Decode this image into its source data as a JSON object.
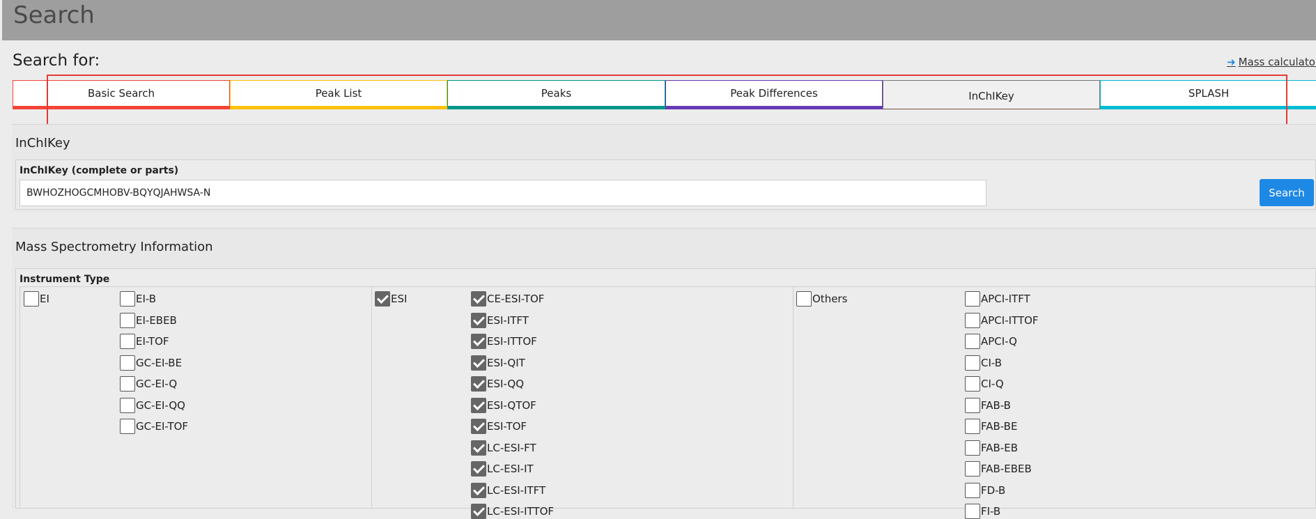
{
  "header": {
    "title": "Search"
  },
  "search_for_label": "Search for:",
  "mass_calculator_link": "Mass calculator",
  "tabs": [
    {
      "label": "Basic Search",
      "color": "#f44336",
      "active": false
    },
    {
      "label": "Peak List",
      "color": "#ffc107",
      "active": false
    },
    {
      "label": "Peaks",
      "color": "#009688",
      "active": false
    },
    {
      "label": "Peak Differences",
      "color": "#673ab7",
      "active": false
    },
    {
      "label": "InChIKey",
      "color": "#795548",
      "active": true
    },
    {
      "label": "SPLASH",
      "color": "#00bcd4",
      "active": false
    }
  ],
  "inchi_panel": {
    "title": "InChIKey",
    "field_label": "InChIKey (complete or parts)",
    "value": "BWHOZHOGCMHOBV-BQYQJAHWSA-N",
    "button_label": "Search"
  },
  "ms_panel": {
    "title": "Mass Spectrometry Information",
    "instrument_label": "Instrument Type",
    "groups": [
      {
        "group": {
          "label": "EI",
          "checked": false
        },
        "items": [
          {
            "label": "EI-B",
            "checked": false
          },
          {
            "label": "EI-EBEB",
            "checked": false
          },
          {
            "label": "EI-TOF",
            "checked": false
          },
          {
            "label": "GC-EI-BE",
            "checked": false
          },
          {
            "label": "GC-EI-Q",
            "checked": false
          },
          {
            "label": "GC-EI-QQ",
            "checked": false
          },
          {
            "label": "GC-EI-TOF",
            "checked": false
          }
        ]
      },
      {
        "group": {
          "label": "ESI",
          "checked": true
        },
        "items": [
          {
            "label": "CE-ESI-TOF",
            "checked": true
          },
          {
            "label": "ESI-ITFT",
            "checked": true
          },
          {
            "label": "ESI-ITTOF",
            "checked": true
          },
          {
            "label": "ESI-QIT",
            "checked": true
          },
          {
            "label": "ESI-QQ",
            "checked": true
          },
          {
            "label": "ESI-QTOF",
            "checked": true
          },
          {
            "label": "ESI-TOF",
            "checked": true
          },
          {
            "label": "LC-ESI-FT",
            "checked": true
          },
          {
            "label": "LC-ESI-IT",
            "checked": true
          },
          {
            "label": "LC-ESI-ITFT",
            "checked": true
          },
          {
            "label": "LC-ESI-ITTOF",
            "checked": true
          }
        ]
      },
      {
        "group": {
          "label": "Others",
          "checked": false
        },
        "items": [
          {
            "label": "APCI-ITFT",
            "checked": false
          },
          {
            "label": "APCI-ITTOF",
            "checked": false
          },
          {
            "label": "APCI-Q",
            "checked": false
          },
          {
            "label": "CI-B",
            "checked": false
          },
          {
            "label": "CI-Q",
            "checked": false
          },
          {
            "label": "FAB-B",
            "checked": false
          },
          {
            "label": "FAB-BE",
            "checked": false
          },
          {
            "label": "FAB-EB",
            "checked": false
          },
          {
            "label": "FAB-EBEB",
            "checked": false
          },
          {
            "label": "FD-B",
            "checked": false
          },
          {
            "label": "FI-B",
            "checked": false
          }
        ]
      }
    ]
  }
}
